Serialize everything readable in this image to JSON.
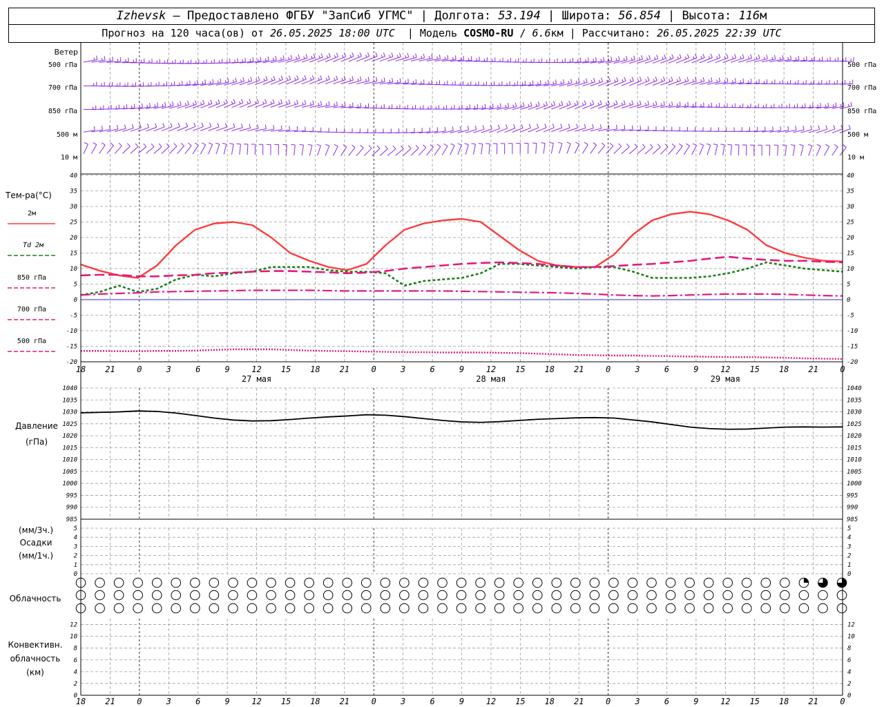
{
  "header": {
    "station": "Izhevsk",
    "provider": "— Предоставлено ФГБУ \"ЗапСиб УГМС\"",
    "lon_label": "Долгота:",
    "lon_value": "53.194",
    "lat_label": "Широта:",
    "lat_value": "56.854",
    "alt_label": "Высота:",
    "alt_value": "116",
    "alt_unit": "м",
    "forecast_label": "Прогноз на 120 часа(ов) от",
    "forecast_start": "26.05.2025 18:00 UTC",
    "model_label": "Модель",
    "model_name": "COSMO-RU",
    "model_res": "6.6",
    "model_res_unit": "км",
    "computed_label": "Рассчитано:",
    "computed_value": "26.05.2025 22:39 UTC"
  },
  "time_axis": {
    "hour_labels": [
      "18",
      "21",
      "0",
      "3",
      "6",
      "9",
      "12",
      "15",
      "18",
      "21",
      "0",
      "3",
      "6",
      "9",
      "12",
      "15",
      "18",
      "21",
      "0",
      "3",
      "6",
      "9",
      "12",
      "15",
      "18",
      "21",
      "0"
    ],
    "dates": [
      {
        "label": "27 мая",
        "hour_index": 6
      },
      {
        "label": "28 мая",
        "hour_index": 14
      },
      {
        "label": "29 мая",
        "hour_index": 22
      }
    ],
    "day_divider_indices": [
      2,
      10,
      18,
      26
    ]
  },
  "wind_panel": {
    "title": "Ветер",
    "levels": [
      "500 гПа",
      "700 гПа",
      "850 гПа",
      "500 м",
      "10 м"
    ],
    "color": "#8a2be2"
  },
  "chart_data": [
    {
      "type": "line",
      "name": "temperature",
      "title": "Тем-ра(°C)",
      "x_hours": [
        0,
        3,
        6,
        9,
        12,
        15,
        18,
        21,
        24,
        27,
        30,
        33,
        36,
        39,
        42,
        45,
        48,
        51,
        54,
        57,
        60,
        63,
        66,
        69,
        72,
        75,
        78,
        81,
        84,
        87,
        90,
        93,
        96,
        99,
        102,
        105,
        108,
        111,
        114,
        117,
        120
      ],
      "ylim": [
        -20,
        40
      ],
      "yticks": [
        -20,
        -15,
        -10,
        -5,
        0,
        5,
        10,
        15,
        20,
        25,
        30,
        35,
        40
      ],
      "series": [
        {
          "name": "2м",
          "color": "#ff3b3b",
          "dash": "solid",
          "width": 2.4,
          "values": [
            11.3,
            9.3,
            7.8,
            7.0,
            11.0,
            17.5,
            22.5,
            24.5,
            25.0,
            24.0,
            20.0,
            15.0,
            12.5,
            10.5,
            9.5,
            11.5,
            17.5,
            22.5,
            24.5,
            25.5,
            26.0,
            25.0,
            20.5,
            16.0,
            12.5,
            11.0,
            10.5,
            10.5,
            14.5,
            21.0,
            25.5,
            27.5,
            28.3,
            27.5,
            25.5,
            22.5,
            17.5,
            15.0,
            13.5,
            12.5,
            12.3
          ]
        },
        {
          "name": "Td 2м",
          "color": "#1e7d1e",
          "dash": "4,3",
          "width": 2.6,
          "values": [
            1.5,
            2.5,
            4.5,
            2.5,
            3.5,
            6.5,
            8.0,
            7.5,
            8.5,
            9.0,
            10.5,
            10.5,
            10.5,
            9.5,
            9.0,
            9.0,
            8.5,
            4.5,
            6.0,
            6.5,
            7.0,
            8.5,
            11.5,
            11.5,
            11.0,
            10.5,
            10.0,
            10.5,
            10.5,
            9.0,
            7.0,
            7.0,
            7.0,
            7.5,
            8.5,
            10.0,
            12.0,
            11.0,
            10.0,
            9.5,
            9.0
          ]
        },
        {
          "name": "850 гПа",
          "color": "#e6177f",
          "dash": "14,6",
          "width": 2.6,
          "values": [
            7.8,
            8.0,
            8.0,
            7.5,
            7.5,
            7.8,
            8.0,
            8.5,
            8.7,
            9.0,
            9.2,
            9.2,
            9.0,
            8.8,
            8.5,
            8.7,
            9.2,
            10.0,
            10.5,
            11.0,
            11.5,
            11.8,
            12.0,
            11.8,
            11.5,
            11.0,
            10.5,
            10.5,
            10.8,
            11.2,
            11.5,
            12.0,
            12.5,
            13.2,
            13.8,
            13.2,
            12.8,
            12.5,
            12.5,
            12.2,
            12.0
          ]
        },
        {
          "name": "700 гПа",
          "color": "#e6177f",
          "dash": "14,4,3,4",
          "width": 2.2,
          "values": [
            1.5,
            1.8,
            2.0,
            2.2,
            2.5,
            2.6,
            2.7,
            2.8,
            2.9,
            3.0,
            3.0,
            3.0,
            3.0,
            2.9,
            2.8,
            2.8,
            2.8,
            2.8,
            2.8,
            2.8,
            2.7,
            2.6,
            2.5,
            2.4,
            2.3,
            2.2,
            2.0,
            1.8,
            1.5,
            1.3,
            1.2,
            1.3,
            1.5,
            1.7,
            1.8,
            1.8,
            1.8,
            1.7,
            1.5,
            1.3,
            1.2
          ]
        },
        {
          "name": "500 гПа",
          "color": "#e6177f",
          "dash": "2,2",
          "width": 2.4,
          "values": [
            -16.5,
            -16.5,
            -16.6,
            -16.6,
            -16.5,
            -16.5,
            -16.4,
            -16.2,
            -16.0,
            -16.0,
            -16.0,
            -16.2,
            -16.4,
            -16.5,
            -16.6,
            -16.7,
            -16.8,
            -16.9,
            -16.9,
            -17.0,
            -17.0,
            -17.0,
            -17.1,
            -17.2,
            -17.4,
            -17.6,
            -17.8,
            -17.9,
            -18.0,
            -18.0,
            -18.1,
            -18.2,
            -18.3,
            -18.4,
            -18.5,
            -18.5,
            -18.6,
            -18.7,
            -18.9,
            -19.0,
            -19.1
          ]
        }
      ]
    },
    {
      "type": "line",
      "name": "pressure",
      "title": "Давление",
      "unit": "(гПа)",
      "x_hours": [
        0,
        3,
        6,
        9,
        12,
        15,
        18,
        21,
        24,
        27,
        30,
        33,
        36,
        39,
        42,
        45,
        48,
        51,
        54,
        57,
        60,
        63,
        66,
        69,
        72,
        75,
        78,
        81,
        84,
        87,
        90,
        93,
        96,
        99,
        102,
        105,
        108,
        111,
        114,
        117,
        120
      ],
      "ylim": [
        985,
        1040
      ],
      "yticks": [
        985,
        990,
        995,
        1000,
        1005,
        1010,
        1015,
        1020,
        1025,
        1030,
        1035,
        1040
      ],
      "series": [
        {
          "name": "Давление",
          "color": "#000000",
          "values": [
            1029.6,
            1029.8,
            1030.0,
            1030.4,
            1030.2,
            1029.5,
            1028.5,
            1027.4,
            1026.6,
            1026.2,
            1026.3,
            1026.8,
            1027.4,
            1027.9,
            1028.3,
            1028.8,
            1028.6,
            1028.0,
            1027.2,
            1026.4,
            1025.8,
            1025.6,
            1025.9,
            1026.4,
            1026.9,
            1027.2,
            1027.5,
            1027.6,
            1027.4,
            1026.6,
            1025.8,
            1024.7,
            1023.6,
            1023.0,
            1022.7,
            1022.8,
            1023.2,
            1023.6,
            1023.7,
            1023.6,
            1023.7
          ]
        }
      ]
    },
    {
      "type": "bar",
      "name": "precipitation",
      "title": "Осадки",
      "unit_3h": "(мм/3ч.)",
      "unit_1h": "(мм/1ч.)",
      "ylim": [
        0,
        5
      ],
      "yticks": [
        0,
        1,
        2,
        3,
        4,
        5
      ],
      "values": []
    },
    {
      "type": "table",
      "name": "cloudiness",
      "title": "Облачность",
      "rows": 3,
      "columns": 41,
      "row_values_percent": [
        [
          0,
          0,
          0,
          0,
          0,
          0,
          0,
          0,
          0,
          0,
          0,
          0,
          0,
          0,
          0,
          0,
          0,
          0,
          0,
          0,
          0,
          0,
          0,
          0,
          0,
          0,
          0,
          0,
          0,
          0,
          0,
          0,
          0,
          0,
          0,
          0,
          0,
          0,
          25,
          75,
          75
        ],
        [
          0,
          0,
          0,
          0,
          0,
          0,
          0,
          0,
          0,
          0,
          0,
          0,
          0,
          0,
          0,
          0,
          0,
          0,
          0,
          0,
          0,
          0,
          0,
          0,
          0,
          0,
          0,
          0,
          0,
          0,
          0,
          0,
          0,
          0,
          0,
          0,
          0,
          0,
          0,
          0,
          0
        ],
        [
          0,
          0,
          0,
          0,
          0,
          0,
          0,
          0,
          0,
          0,
          0,
          0,
          0,
          0,
          0,
          0,
          0,
          0,
          0,
          0,
          0,
          0,
          0,
          0,
          0,
          0,
          0,
          0,
          0,
          0,
          0,
          0,
          0,
          0,
          0,
          0,
          0,
          0,
          0,
          0,
          0
        ]
      ]
    },
    {
      "type": "bar",
      "name": "convective_cloud",
      "title": "Конвективн.",
      "title2": "облачность",
      "unit": "(км)",
      "ylim": [
        0,
        13
      ],
      "yticks": [
        0,
        2,
        4,
        6,
        8,
        10,
        12
      ],
      "values": []
    }
  ]
}
